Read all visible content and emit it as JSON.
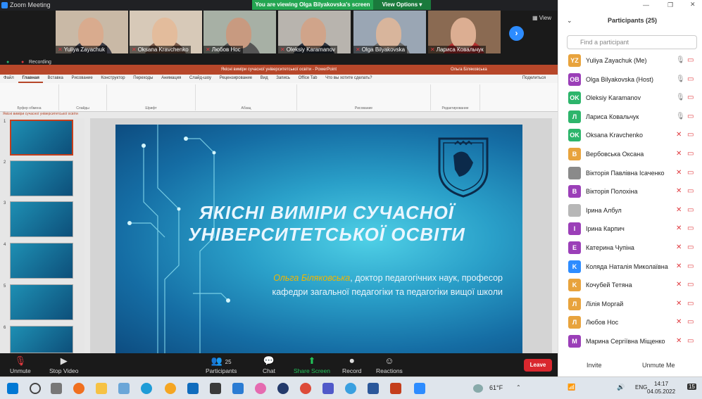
{
  "zoom": {
    "title": "Zoom Meeting",
    "viewing_banner": "You are viewing Olga Bilyakovska's screen",
    "view_options": "View Options",
    "view_button": "View",
    "recording": "Recording",
    "video_tiles": [
      {
        "name": "Yuliya Zayachuk"
      },
      {
        "name": "Oksana Kravchenko"
      },
      {
        "name": "Любов Нос"
      },
      {
        "name": "Oleksiy Karamanov"
      },
      {
        "name": "Olga Bilyakovska"
      },
      {
        "name": "Лариса Ковальчук"
      }
    ],
    "toolbar": {
      "unmute": "Unmute",
      "stop_video": "Stop Video",
      "participants": "Participants",
      "participants_count": "25",
      "chat": "Chat",
      "share_screen": "Share Screen",
      "record": "Record",
      "reactions": "Reactions",
      "leave": "Leave"
    }
  },
  "ppt": {
    "window_title": "Якісні виміри сучасної університетської освіти  -  PowerPoint",
    "user": "Ольга Біляковська",
    "tabs": [
      "Файл",
      "Главная",
      "Вставка",
      "Рисование",
      "Конструктор",
      "Переходы",
      "Анимация",
      "Слайд-шоу",
      "Рецензирование",
      "Вид",
      "Запись",
      "Office Tab",
      "Что вы хотите сделать?"
    ],
    "share": "Поделиться",
    "groups": [
      "Буфер обмена",
      "Слайды",
      "Шрифт",
      "Абзац",
      "Рисование",
      "Редактирование"
    ],
    "doc_tab": "Якісні виміри сучасної університетської освіти",
    "slide_numbers": [
      "1",
      "2",
      "3",
      "4",
      "5",
      "6"
    ],
    "slide": {
      "title": "ЯКІСНІ ВИМІРИ СУЧАСНОЇ УНІВЕРСИТЕТСЬКОЇ ОСВІТИ",
      "author": "Ольга Біляковська",
      "subtitle_rest": ", доктор педагогічних наук, професор",
      "subtitle_line2": "кафедри загальної педагогіки та педагогіки вищої школи"
    }
  },
  "participants": {
    "header": "Participants (25)",
    "search_placeholder": "Find a participant",
    "list": [
      {
        "initials": "YZ",
        "name": "Yuliya Zayachuk (Me)",
        "color": "#e8a33d"
      },
      {
        "initials": "OB",
        "name": "Olga Bilyakovska (Host)",
        "color": "#9b3fb8"
      },
      {
        "initials": "OK",
        "name": "Oleksiy Karamanov",
        "color": "#2db56b"
      },
      {
        "initials": "Л",
        "name": "Лариса Ковальчук",
        "color": "#2db56b"
      },
      {
        "initials": "OK",
        "name": "Oksana Kravchenko",
        "color": "#2db56b"
      },
      {
        "initials": "В",
        "name": "Вербовська Оксана",
        "color": "#e8a33d"
      },
      {
        "initials": "",
        "name": "Вікторія Павлівна Ісаченко",
        "color": "#8a8a8a"
      },
      {
        "initials": "В",
        "name": "Вікторія Полохіна",
        "color": "#9b3fb8"
      },
      {
        "initials": "",
        "name": "Ірина Албул",
        "color": "#b7b7b7"
      },
      {
        "initials": "I",
        "name": "Ірина Карпич",
        "color": "#9b3fb8"
      },
      {
        "initials": "E",
        "name": "Катерина Чупіна",
        "color": "#9b3fb8"
      },
      {
        "initials": "K",
        "name": "Коляда Наталія Миколаївна",
        "color": "#2d8cff"
      },
      {
        "initials": "K",
        "name": "Кочубей Тетяна",
        "color": "#e8a33d"
      },
      {
        "initials": "Л",
        "name": "Лілія Моргай",
        "color": "#e8a33d"
      },
      {
        "initials": "Л",
        "name": "Любов Нос",
        "color": "#e8a33d"
      },
      {
        "initials": "M",
        "name": "Марина Сергіївна Міщенко",
        "color": "#9b3fb8"
      }
    ],
    "invite": "Invite",
    "unmute_me": "Unmute Me"
  },
  "taskbar": {
    "temperature": "61°F",
    "language": "ENG",
    "time": "14:17",
    "date": "04.05.2022",
    "notifications": "15"
  }
}
